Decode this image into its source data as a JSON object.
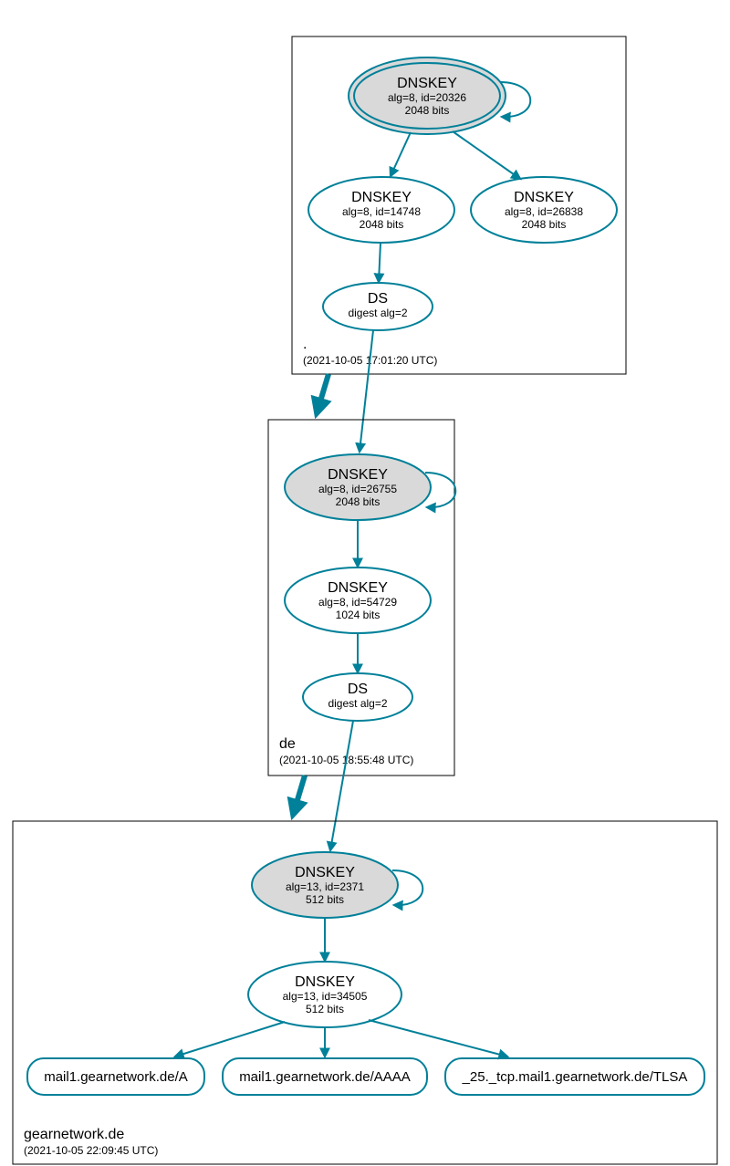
{
  "colors": {
    "stroke": "#008099",
    "node_fill_grey": "#d9d9d9",
    "node_fill_white": "#ffffff"
  },
  "zones": {
    "root": {
      "label": ".",
      "timestamp": "(2021-10-05 17:01:20 UTC)"
    },
    "de": {
      "label": "de",
      "timestamp": "(2021-10-05 18:55:48 UTC)"
    },
    "domain": {
      "label": "gearnetwork.de",
      "timestamp": "(2021-10-05 22:09:45 UTC)"
    }
  },
  "nodes": {
    "root_ksk": {
      "title": "DNSKEY",
      "line1": "alg=8, id=20326",
      "line2": "2048 bits"
    },
    "root_zsk": {
      "title": "DNSKEY",
      "line1": "alg=8, id=14748",
      "line2": "2048 bits"
    },
    "root_other": {
      "title": "DNSKEY",
      "line1": "alg=8, id=26838",
      "line2": "2048 bits"
    },
    "root_ds": {
      "title": "DS",
      "line1": "digest alg=2"
    },
    "de_ksk": {
      "title": "DNSKEY",
      "line1": "alg=8, id=26755",
      "line2": "2048 bits"
    },
    "de_zsk": {
      "title": "DNSKEY",
      "line1": "alg=8, id=54729",
      "line2": "1024 bits"
    },
    "de_ds": {
      "title": "DS",
      "line1": "digest alg=2"
    },
    "dom_ksk": {
      "title": "DNSKEY",
      "line1": "alg=13, id=2371",
      "line2": "512 bits"
    },
    "dom_zsk": {
      "title": "DNSKEY",
      "line1": "alg=13, id=34505",
      "line2": "512 bits"
    },
    "rr_a": {
      "title": "mail1.gearnetwork.de/A"
    },
    "rr_aaaa": {
      "title": "mail1.gearnetwork.de/AAAA"
    },
    "rr_tlsa": {
      "title": "_25._tcp.mail1.gearnetwork.de/TLSA"
    }
  }
}
